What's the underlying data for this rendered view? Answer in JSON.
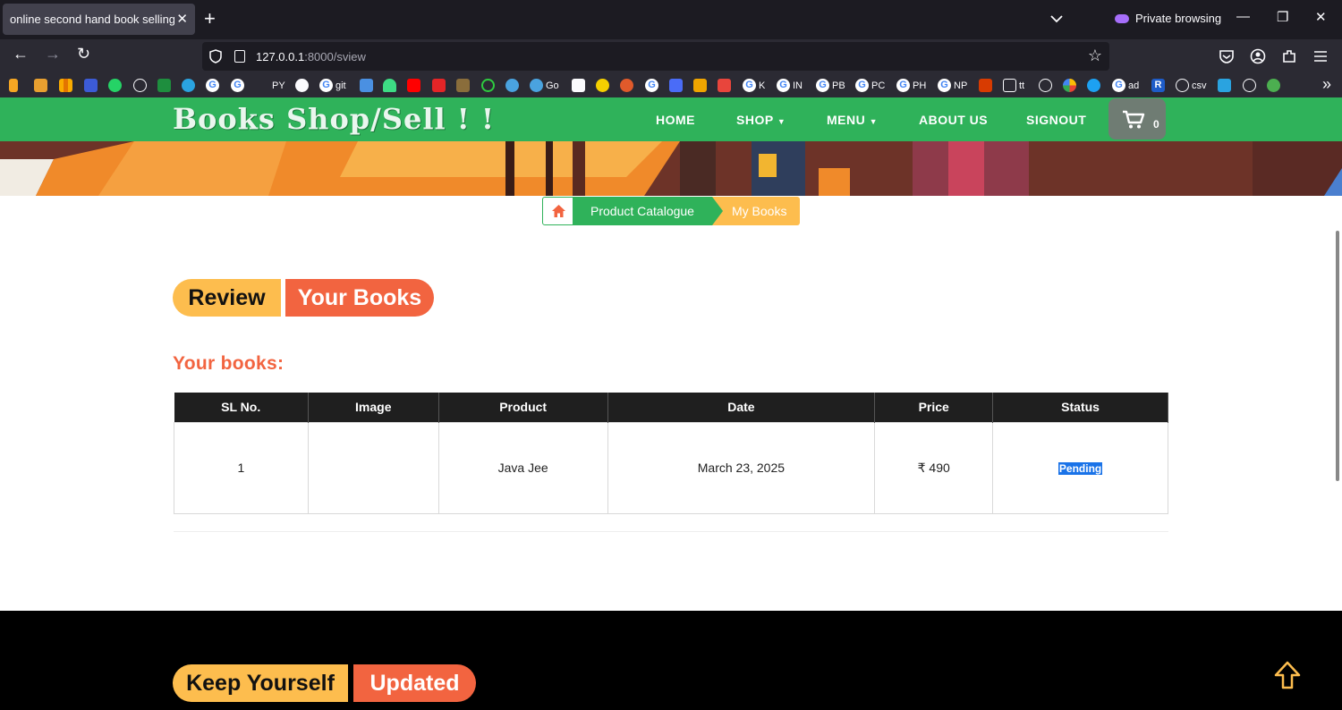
{
  "browser": {
    "tab_title": "online second hand book selling sys",
    "tab_close": "✕",
    "new_tab": "+",
    "private_label": "Private browsing",
    "url_host": "127.0.0.1",
    "url_rest": ":8000/sview",
    "bookmarks": [
      "PY",
      "git",
      "Go",
      "K",
      "IN",
      "PB",
      "PC",
      "PH",
      "NP",
      "tt",
      "ad",
      "csv"
    ]
  },
  "site": {
    "logo": "Books Shop/Sell ! !",
    "menu": {
      "home": "HOME",
      "shop": "SHOP",
      "menu": "MENU",
      "about": "ABOUT US",
      "signout": "SIGNOUT"
    },
    "cart_count": "0"
  },
  "breadcrumb": {
    "catalogue": "Product Catalogue",
    "current": "My Books"
  },
  "section": {
    "pill_left": "Review",
    "pill_right": "Your Books",
    "subtitle": "Your books:"
  },
  "table": {
    "headers": [
      "SL No.",
      "Image",
      "Product",
      "Date",
      "Price",
      "Status"
    ],
    "rows": [
      {
        "sl": "1",
        "image": "",
        "product": "Java Jee",
        "date": "March 23, 2025",
        "price": "₹ 490",
        "status": "Pending"
      }
    ]
  },
  "footer": {
    "pill_left": "Keep Yourself",
    "pill_right": "Updated"
  },
  "colors": {
    "brand_green": "#2fb25a",
    "accent_yellow": "#fdbd4e",
    "accent_orange": "#f26440"
  }
}
